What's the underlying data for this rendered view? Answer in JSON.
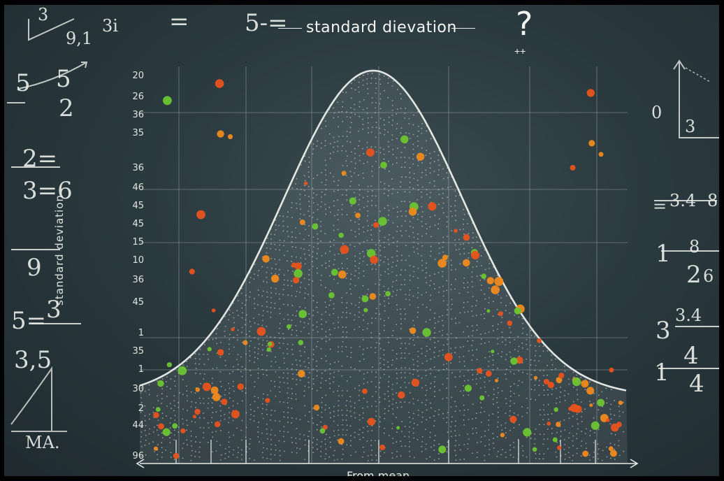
{
  "title": "standard dievation",
  "axis": {
    "y_tick_labels": [
      "20",
      "26",
      "36",
      "35",
      "36",
      "46",
      "45",
      "45",
      "15",
      "10",
      "36",
      "45",
      "1",
      "35",
      "1",
      "30",
      "2",
      "44",
      "96"
    ],
    "vertical_label": "standard deviation",
    "x_label": "From mean"
  },
  "chalk": {
    "top_left": [
      "3",
      "9,1",
      "3i"
    ],
    "top_center": [
      "=",
      "5-="
    ],
    "question_mark": "?",
    "plus_marks": "++",
    "left_column": [
      "5",
      "5",
      "2",
      "2=",
      "3=6",
      "9",
      "3",
      "5=",
      "3,5",
      "MA."
    ],
    "right_column": [
      "0",
      "3",
      "=",
      "3.4",
      "8",
      "1",
      "8",
      "2",
      "6",
      "3",
      "3.4",
      "1",
      "4",
      "4"
    ]
  },
  "colors": {
    "board": "#2b3a3f",
    "chalk": "#e8ece8",
    "orange": "#f08a1c",
    "red_orange": "#e8531e",
    "green": "#6cc531"
  }
}
